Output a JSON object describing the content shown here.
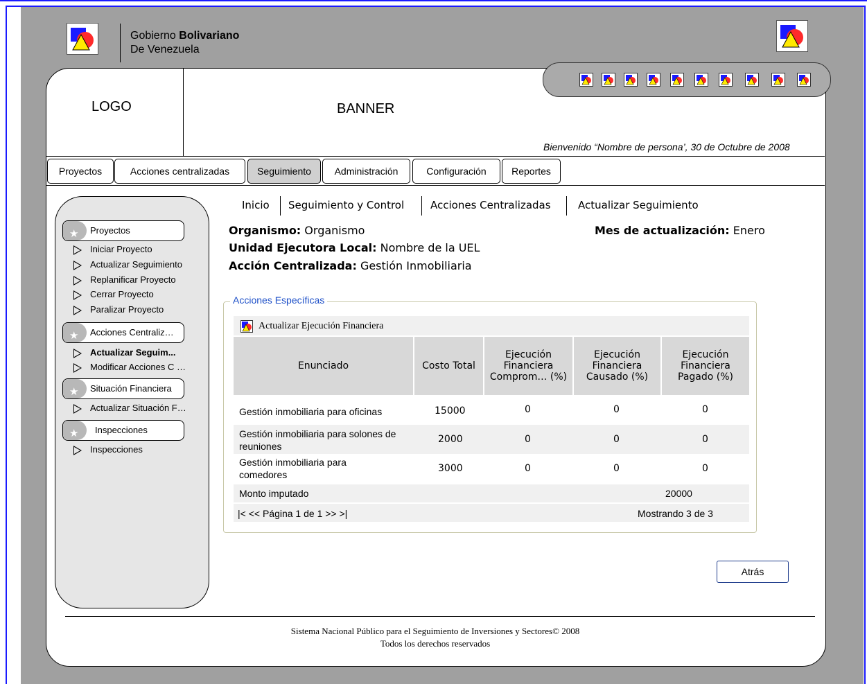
{
  "header": {
    "gov_line1_prefix": "Gobierno",
    "gov_line1_bold": "Bolivariano",
    "gov_line2": "De Venezuela",
    "logo_label": "LOGO",
    "banner_label": "BANNER",
    "welcome": "Bienvenido “Nombre de persona’, 30 de Octubre de 2008"
  },
  "nav": {
    "tabs": [
      {
        "label": "Proyectos"
      },
      {
        "label": "Acciones centralizadas"
      },
      {
        "label": "Seguimiento",
        "active": true
      },
      {
        "label": "Administración"
      },
      {
        "label": "Configuración"
      },
      {
        "label": "Reportes"
      }
    ]
  },
  "sidebar": {
    "sections": [
      {
        "title": "Proyectos",
        "items": [
          "Iniciar Proyecto",
          "Actualizar Seguimiento",
          "Replanificar Proyecto",
          "Cerrar Proyecto",
          "Paralizar Proyecto"
        ]
      },
      {
        "title": "Acciones Centraliz…",
        "items": [
          "Actualizar Seguim...",
          "Modificar Acciones C …"
        ]
      },
      {
        "title": "Situación Financiera",
        "items": [
          "Actualizar Situación F…"
        ]
      },
      {
        "title": "Inspecciones",
        "items": [
          "Inspecciones"
        ]
      }
    ]
  },
  "breadcrumb": [
    "Inicio",
    "Seguimiento y Control",
    "Acciones Centralizadas",
    "Actualizar Seguimiento"
  ],
  "info": {
    "organismo_label": "Organismo:",
    "organismo_value": "Organismo",
    "uel_label": "Unidad Ejecutora Local:",
    "uel_value": "Nombre de la UEL",
    "accion_label": "Acción Centralizada:",
    "accion_value": "Gestión Inmobiliaria",
    "mes_label": "Mes de actualización:",
    "mes_value": "Enero"
  },
  "panel": {
    "legend": "Acciones Específicas",
    "table_title": "Actualizar Ejecución Financiera",
    "columns": [
      "Enunciado",
      "Costo Total",
      "Ejecución Financiera Comprom… (%)",
      "Ejecución Financiera Causado (%)",
      "Ejecución Financiera Pagado (%)"
    ],
    "rows": [
      [
        "Gestión inmobiliaria para oficinas",
        "15000",
        "0",
        "0",
        "0"
      ],
      [
        "Gestión inmobiliaria para solones de reuniones",
        "2000",
        "0",
        "0",
        "0"
      ],
      [
        "Gestión inmobiliaria para comedores",
        "3000",
        "0",
        "0",
        "0"
      ]
    ],
    "total_label": "Monto imputado",
    "total_value": "20000",
    "pager": "|<  << Página 1 de 1 >>  >|",
    "showing": "Mostrando 3 de 3"
  },
  "back_button": "Atrás",
  "footer": {
    "line1": "Sistema Nacional Público para el Seguimiento de Inversiones y Sectores© 2008",
    "line2": "Todos los derechos reservados"
  },
  "colors": {
    "accent_blue": "#1e50c8",
    "canvas_gray": "#a0a0a0"
  }
}
